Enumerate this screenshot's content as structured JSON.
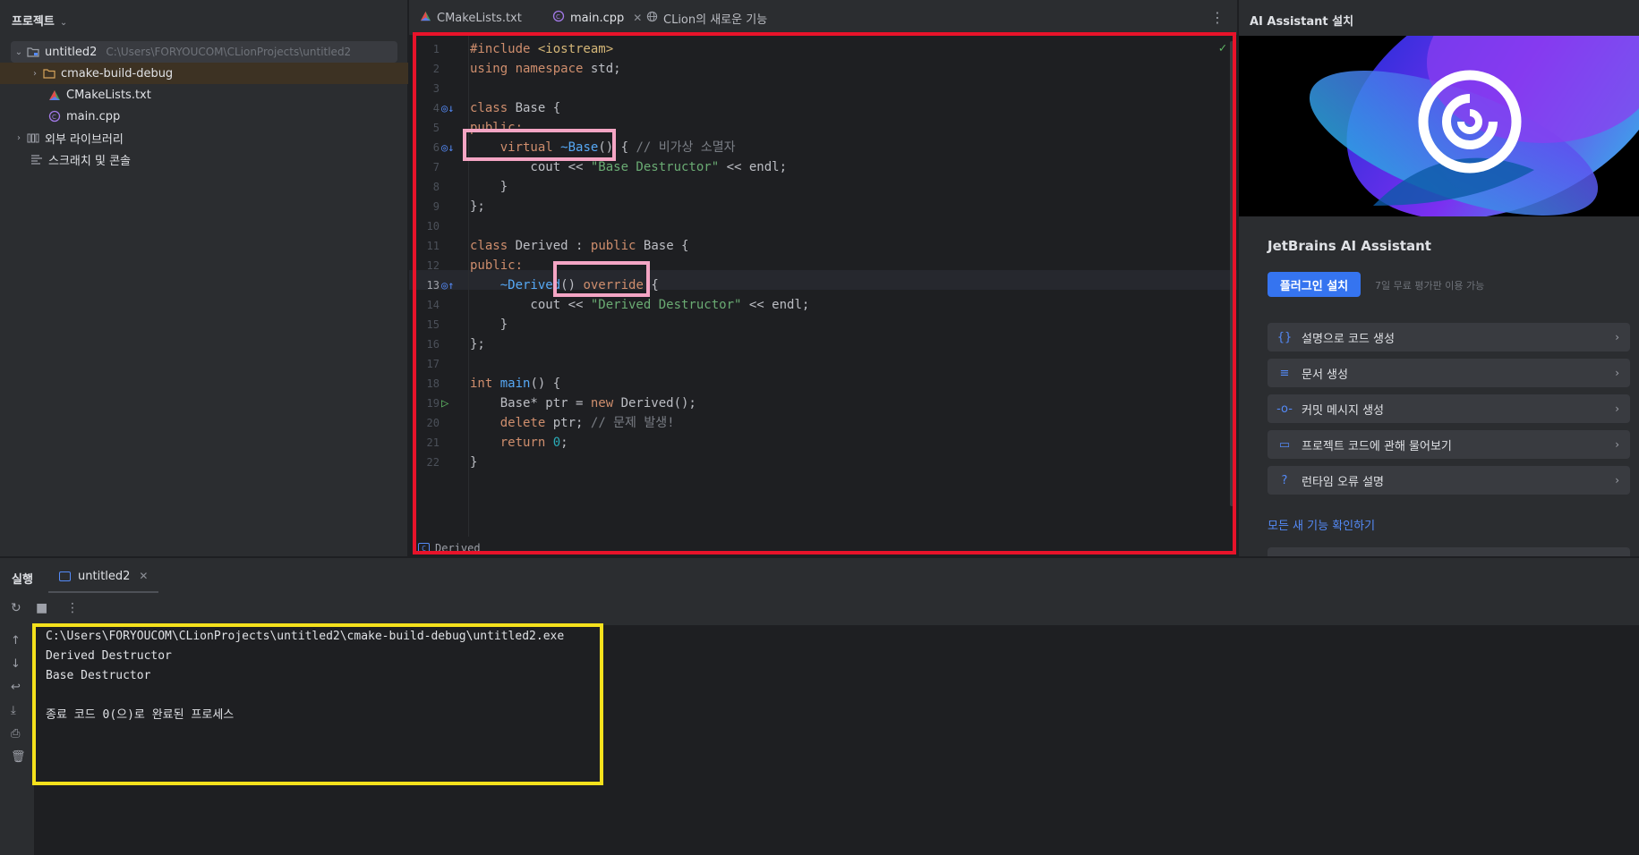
{
  "project": {
    "header": "프로젝트",
    "items": [
      {
        "label": "untitled2",
        "path": "C:\\Users\\FORYOUCOM\\CLionProjects\\untitled2"
      },
      {
        "label": "cmake-build-debug"
      },
      {
        "label": "CMakeLists.txt"
      },
      {
        "label": "main.cpp"
      },
      {
        "label": "외부 라이브러리"
      },
      {
        "label": "스크래치 및 콘솔"
      }
    ]
  },
  "editor": {
    "tabs": [
      {
        "label": "CMakeLists.txt"
      },
      {
        "label": "main.cpp"
      },
      {
        "label": "CLion의 새로운 기능"
      }
    ],
    "line_numbers": [
      "1",
      "2",
      "3",
      "4",
      "5",
      "6",
      "7",
      "8",
      "9",
      "10",
      "11",
      "12",
      "13",
      "14",
      "15",
      "16",
      "17",
      "18",
      "19",
      "20",
      "21",
      "22"
    ],
    "code": {
      "l1a": "#include ",
      "l1b": "<iostream>",
      "l2a": "using namespace ",
      "l2b": "std;",
      "l4a": "class ",
      "l4b": "Base {",
      "l5": "public:",
      "l6a": "    virtual ",
      "l6b": "~Base",
      "l6c": "() { ",
      "l6d": "// 비가상 소멸자",
      "l7a": "        cout << ",
      "l7b": "\"Base Destructor\"",
      "l7c": " << endl;",
      "l8": "    }",
      "l9": "};",
      "l11a": "class ",
      "l11b": "Derived",
      "l11c": " : ",
      "l11d": "public ",
      "l11e": "Base {",
      "l12": "public:",
      "l13a": "    ",
      "l13b": "~Derived",
      "l13c": "() ",
      "l13d": "override",
      "l13e": " {",
      "l14a": "        cout << ",
      "l14b": "\"Derived Destructor\"",
      "l14c": " << endl;",
      "l15": "    }",
      "l16": "};",
      "l18a": "int ",
      "l18b": "main",
      "l18c": "() {",
      "l19a": "    Base* ptr = ",
      "l19b": "new ",
      "l19c": "Derived();",
      "l20a": "    ",
      "l20b": "delete ",
      "l20c": "ptr; ",
      "l20d": "// 문제 발생!",
      "l21a": "    ",
      "l21b": "return ",
      "l21c": "0",
      "l21d": ";",
      "l22": "}"
    },
    "breadcrumb": "Derived"
  },
  "ai": {
    "title": "AI Assistant 설치",
    "heading": "JetBrains AI Assistant",
    "install_label": "플러그인 설치",
    "trial_note": "7일 무료 평가판 이용 가능",
    "features": [
      {
        "label": "설명으로 코드 생성"
      },
      {
        "label": "문서 생성"
      },
      {
        "label": "커밋 메시지 생성"
      },
      {
        "label": "프로젝트 코드에 관해 물어보기"
      },
      {
        "label": "런타임 오류 설명"
      }
    ],
    "all_features": "모든 새 기능 확인하기"
  },
  "run": {
    "title": "실행",
    "tab": "untitled2",
    "output": [
      "C:\\Users\\FORYOUCOM\\CLionProjects\\untitled2\\cmake-build-debug\\untitled2.exe",
      "Derived Destructor",
      "Base Destructor",
      "",
      "종료 코드 0(으)로 완료된 프로세스"
    ]
  },
  "colors": {
    "accent": "#3574f0",
    "highlight_red": "#e8132a",
    "highlight_pink": "#f4a5c4",
    "highlight_yellow": "#f5e11c"
  }
}
